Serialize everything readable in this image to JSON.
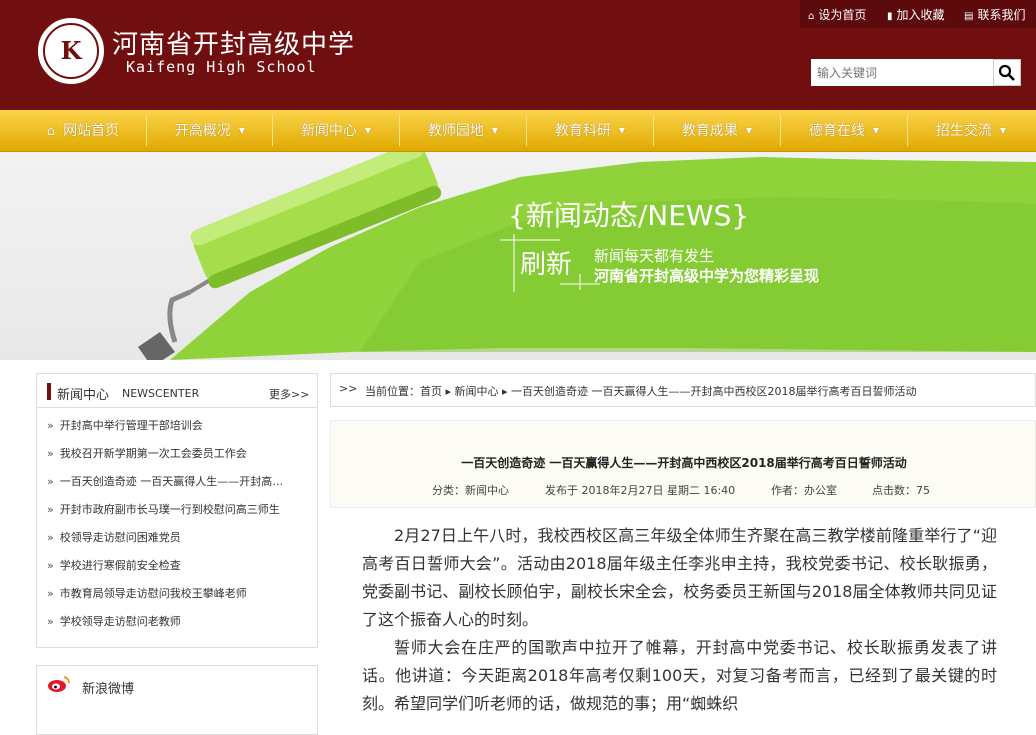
{
  "header": {
    "school_name": "河南省开封高级中学",
    "school_name_en": "Kaifeng High School",
    "logo_mark": "K",
    "top_links": [
      {
        "label": "设为首页",
        "icon": "home-icon"
      },
      {
        "label": "加入收藏",
        "icon": "bookmark-icon"
      },
      {
        "label": "联系我们",
        "icon": "contact-icon"
      }
    ],
    "search_placeholder": "输入关键词"
  },
  "nav": {
    "items": [
      {
        "label": "网站首页",
        "dropdown": false
      },
      {
        "label": "开高概况",
        "dropdown": true
      },
      {
        "label": "新闻中心",
        "dropdown": true
      },
      {
        "label": "教师园地",
        "dropdown": true
      },
      {
        "label": "教育科研",
        "dropdown": true
      },
      {
        "label": "教育成果",
        "dropdown": true
      },
      {
        "label": "德育在线",
        "dropdown": true
      },
      {
        "label": "招生交流",
        "dropdown": true
      }
    ]
  },
  "banner": {
    "title": "{新闻动态/NEWS}",
    "word": "刷新",
    "line1": "新闻每天都有发生",
    "line2": "河南省开封高级中学为您精彩呈现"
  },
  "sidebar": {
    "title": "新闻中心",
    "title_en": "NEWSCENTER",
    "more": "更多>>",
    "bullet": "»",
    "items": [
      "开封高中举行管理干部培训会",
      "我校召开新学期第一次工会委员工作会",
      "一百天创造奇迹 一百天赢得人生——开封高…",
      "开封市政府副市长马璞一行到校慰问高三师生",
      "校领导走访慰问困难党员",
      "学校进行寒假前安全检查",
      "市教育局领导走访慰问我校王攀峰老师",
      "学校领导走访慰问老教师"
    ],
    "weibo_title": "新浪微博"
  },
  "breadcrumb": {
    "icon": ">>",
    "text": "当前位置：首页 ▸ 新闻中心 ▸ 一百天创造奇迹 一百天赢得人生——开封高中西校区2018届举行高考百日誓师活动"
  },
  "article": {
    "title": "一百天创造奇迹 一百天赢得人生——开封高中西校区2018届举行高考百日誓师活动",
    "category": "分类：新闻中心",
    "published": "发布于 2018年2月27日 星期二 16:40",
    "author": "作者：办公室",
    "clicks": "点击数：75",
    "paragraphs": [
      "2月27日上午八时，我校西校区高三年级全体师生齐聚在高三教学楼前隆重举行了“迎高考百日誓师大会”。活动由2018届年级主任李兆申主持，我校党委书记、校长耿振勇，党委副书记、副校长顾伯宇，副校长宋全会，校务委员王新国与2018届全体教师共同见证了这个振奋人心的时刻。",
      "誓师大会在庄严的国歌声中拉开了帷幕，开封高中党委书记、校长耿振勇发表了讲话。他讲道：今天距离2018年高考仅剩100天，对复习备考而言，已经到了最关键的时刻。希望同学们听老师的话，做规范的事；用“蜘蛛织"
    ]
  },
  "colors": {
    "header_bg": "#710e10",
    "nav_gold": "#f2c12e",
    "banner_green": "#8fd23a"
  }
}
